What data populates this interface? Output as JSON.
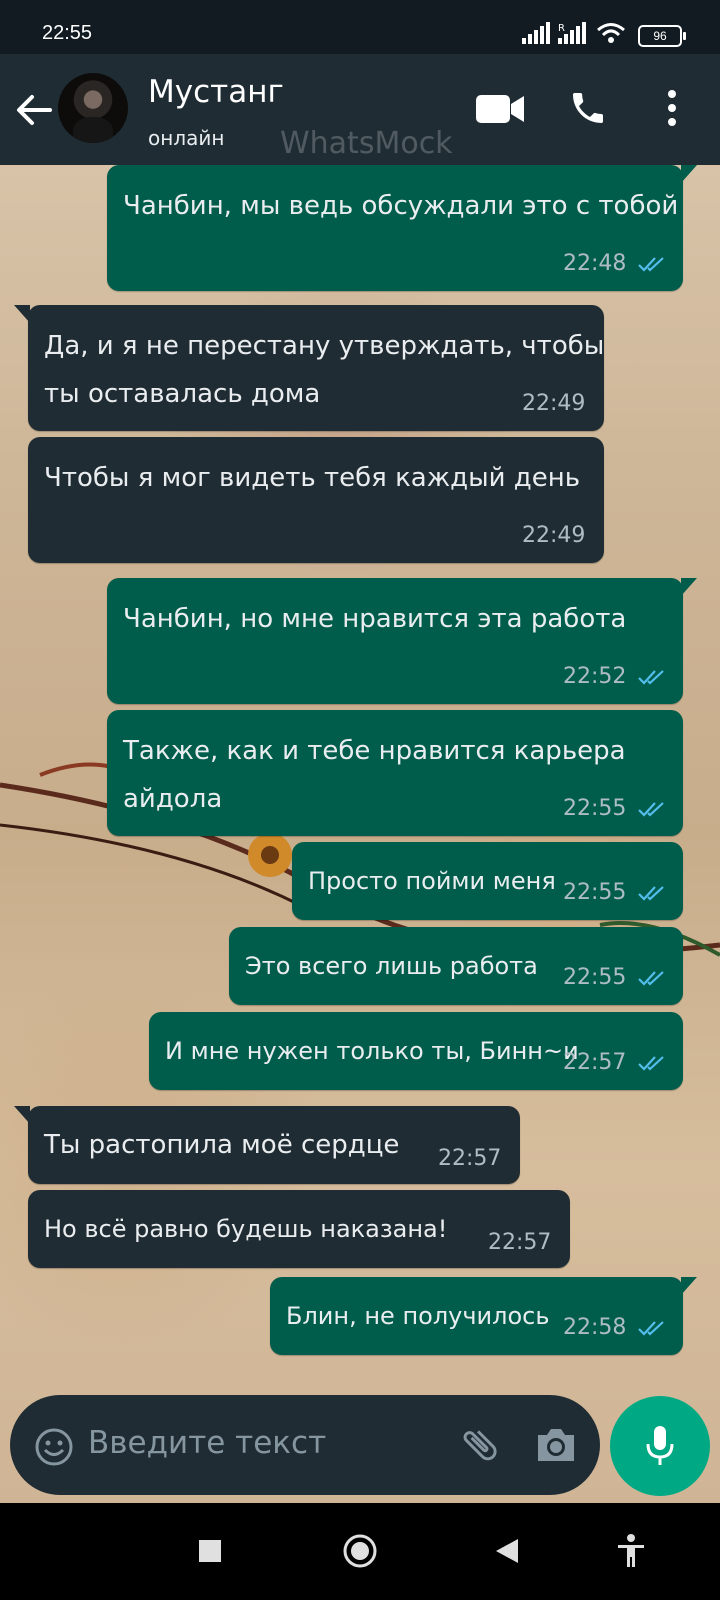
{
  "status_bar": {
    "time": "22:55",
    "battery": "96"
  },
  "header": {
    "contact_name": "Мустанг",
    "contact_status": "онлайн",
    "watermark": "WhatsMock"
  },
  "messages": [
    {
      "direction": "out",
      "text": "Чанбин, мы ведь обсуждали это с тобой",
      "time": "22:48",
      "read": true
    },
    {
      "direction": "in",
      "text_lines": [
        "Да, и я не перестану утверждать, чтобы",
        "ты оставалась дома"
      ],
      "time": "22:49"
    },
    {
      "direction": "in",
      "text": "Чтобы я мог видеть тебя каждый день",
      "time": "22:49"
    },
    {
      "direction": "out",
      "text": "Чанбин, но мне нравится эта работа",
      "time": "22:52",
      "read": true
    },
    {
      "direction": "out",
      "text_lines": [
        "Также, как и тебе нравится карьера",
        "айдола"
      ],
      "time": "22:55",
      "read": true
    },
    {
      "direction": "out",
      "text": "Просто пойми меня",
      "time": "22:55",
      "read": true
    },
    {
      "direction": "out",
      "text": "Это всего лишь работа",
      "time": "22:55",
      "read": true
    },
    {
      "direction": "out",
      "text": "И мне нужен только ты, Бинн~и",
      "time": "22:57",
      "read": true
    },
    {
      "direction": "in",
      "text": "Ты растопила моё сердце",
      "time": "22:57"
    },
    {
      "direction": "in",
      "text": "Но всё равно будешь наказана!",
      "time": "22:57"
    },
    {
      "direction": "out",
      "text": "Блин, не получилось",
      "time": "22:58",
      "read": true
    }
  ],
  "input": {
    "placeholder": "Введите текст"
  },
  "colors": {
    "outgoing_bubble": "#005c4b",
    "incoming_bubble": "#202c33",
    "accent": "#00a884",
    "read_ticks": "#53bdeb"
  },
  "icons": [
    "back-arrow-icon",
    "video-call-icon",
    "phone-icon",
    "more-options-icon",
    "emoji-icon",
    "attach-icon",
    "camera-icon",
    "mic-icon",
    "nav-square-icon",
    "nav-home-icon",
    "nav-back-icon",
    "accessibility-icon"
  ]
}
